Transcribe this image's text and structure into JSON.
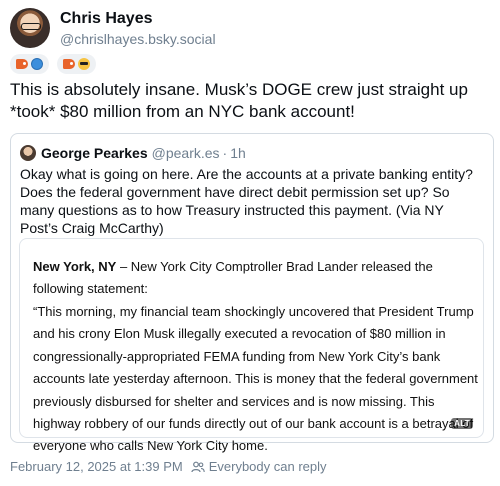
{
  "author": {
    "display_name": "Chris Hayes",
    "handle": "@chrislhayes.bsky.social"
  },
  "badges": [
    {
      "icons": [
        "tag-icon",
        "globe-icon"
      ]
    },
    {
      "icons": [
        "tag-icon",
        "sunglasses-emoji-icon"
      ]
    }
  ],
  "post": {
    "text": "This is absolutely insane. Musk’s DOGE crew just straight up *took* $80 million from an NYC bank account!"
  },
  "quote": {
    "author_name": "George Pearkes",
    "author_handle": "@peark.es",
    "separator": "·",
    "time": "1h",
    "text": "Okay what is going on here. Are the accounts at a private banking entity? Does the federal government have direct debit permission set up? So many questions as to how Treasury instructed this payment. (Via NY Post’s Craig McCarthy)",
    "embed": {
      "dateline": "New York, NY",
      "lead": " – New York City Comptroller Brad Lander released the following statement:",
      "statement": "“This morning, my financial team shockingly uncovered that President Trump and his crony Elon Musk illegally executed a revocation of $80 million in congressionally-appropriated FEMA funding from New York City’s bank accounts late yesterday afternoon. This is money that the federal government previously disbursed for shelter and services and is now missing. This highway robbery of our funds directly out of our bank account is a betrayal of everyone who calls New York City home.",
      "alt_label": "ALT"
    }
  },
  "meta": {
    "timestamp": "February 12, 2025 at 1:39 PM",
    "reply_setting": "Everybody can reply"
  }
}
